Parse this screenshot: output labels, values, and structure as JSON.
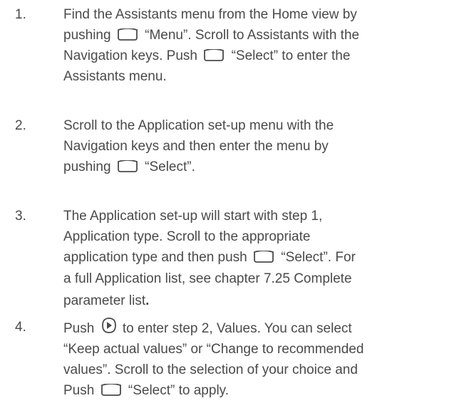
{
  "steps": [
    {
      "number": "1.",
      "lines": [
        [
          "Find the Assistants menu from the Home view by"
        ],
        [
          "pushing",
          "softkey-icon",
          "“Menu”. Scroll to Assistants with the"
        ],
        [
          "Navigation keys. Push",
          "softkey-icon",
          "“Select” to enter the"
        ],
        [
          "Assistants menu."
        ]
      ]
    },
    {
      "number": "2.",
      "lines": [
        [
          "Scroll to the Application set-up menu with the"
        ],
        [
          "Navigation keys and then enter the menu by"
        ],
        [
          "pushing",
          "softkey-icon",
          "“Select”."
        ]
      ]
    },
    {
      "number": "3.",
      "lines": [
        [
          "The Application set-up will start with step 1,"
        ],
        [
          "Application type. Scroll to the appropriate"
        ],
        [
          "application type and then push",
          "softkey-icon",
          "“Select”. For"
        ],
        [
          "a full Application list, see"
        ],
        [
          "parameter list"
        ]
      ],
      "link_text": "chapter 7.25 Complete",
      "end_dot": "."
    },
    {
      "number": "4.",
      "lines": [
        [
          "Push",
          "navkey-icon",
          "to enter step 2, Values. You can select"
        ],
        [
          "“Keep actual values” or “Change to recommended"
        ],
        [
          "values”. Scroll to the selection of your choice and"
        ],
        [
          "Push",
          "softkey-icon",
          "“Select” to apply."
        ]
      ]
    }
  ]
}
